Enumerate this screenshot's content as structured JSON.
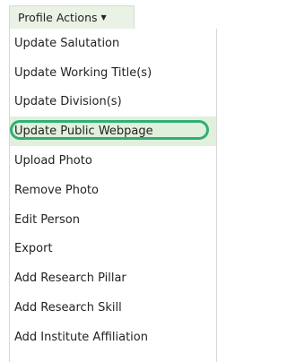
{
  "dropdown": {
    "trigger_label": "Profile Actions",
    "caret_glyph": "▼",
    "highlighted_item": "Update Public Webpage",
    "highlight_color": "#2eae7a",
    "items": [
      {
        "label": "Update Salutation"
      },
      {
        "label": "Update Working Title(s)"
      },
      {
        "label": "Update Division(s)"
      },
      {
        "label": "Update Public Webpage"
      },
      {
        "label": "Upload Photo"
      },
      {
        "label": "Remove Photo"
      },
      {
        "label": "Edit Person"
      },
      {
        "label": "Export"
      },
      {
        "label": "Add Research Pillar"
      },
      {
        "label": "Add Research Skill"
      },
      {
        "label": "Add Institute Affiliation"
      }
    ]
  }
}
